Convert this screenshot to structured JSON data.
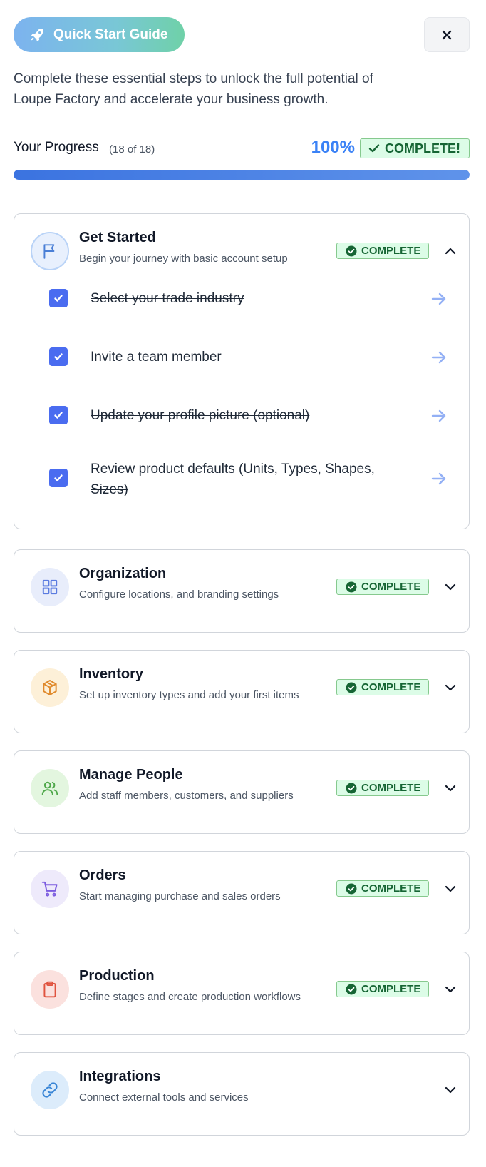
{
  "header": {
    "title": "Quick Start Guide",
    "close_label": "Close"
  },
  "intro": "Complete these essential steps to unlock the full potential of Loupe Factory and accelerate your business growth.",
  "progress": {
    "title": "Your Progress",
    "count": "(18 of 18)",
    "percent_label": "100%",
    "fraction": 1.0,
    "status": "COMPLETE!"
  },
  "sections": [
    {
      "title": "Get Started",
      "description": "Begin your journey with basic account setup",
      "status": "COMPLETE",
      "expanded": true,
      "icon": "flag-icon",
      "tasks": [
        {
          "label": "Select your trade industry",
          "done": true
        },
        {
          "label": "Invite a team member",
          "done": true
        },
        {
          "label": "Update your profile picture (optional)",
          "done": true
        },
        {
          "label": "Review product defaults (Units, Types, Shapes, Sizes)",
          "done": true
        }
      ]
    },
    {
      "title": "Organization",
      "description": "Configure locations, and branding settings",
      "status": "COMPLETE",
      "icon": "grid-icon"
    },
    {
      "title": "Inventory",
      "description": "Set up inventory types and add your first items",
      "status": "COMPLETE",
      "icon": "box-icon"
    },
    {
      "title": "Manage People",
      "description": "Add staff members, customers, and suppliers",
      "status": "COMPLETE",
      "icon": "users-icon"
    },
    {
      "title": "Orders",
      "description": "Start managing purchase and sales orders",
      "status": "COMPLETE",
      "icon": "cart-icon"
    },
    {
      "title": "Production",
      "description": "Define stages and create production workflows",
      "status": "COMPLETE",
      "icon": "clipboard-icon"
    },
    {
      "title": "Integrations",
      "description": "Connect external tools and services",
      "status": "",
      "icon": "link-icon"
    }
  ],
  "colors": {
    "accent": "#3b82f6",
    "complete_bg": "#dcfce7",
    "complete_text": "#166534",
    "checkbox": "#4a6cf0"
  }
}
